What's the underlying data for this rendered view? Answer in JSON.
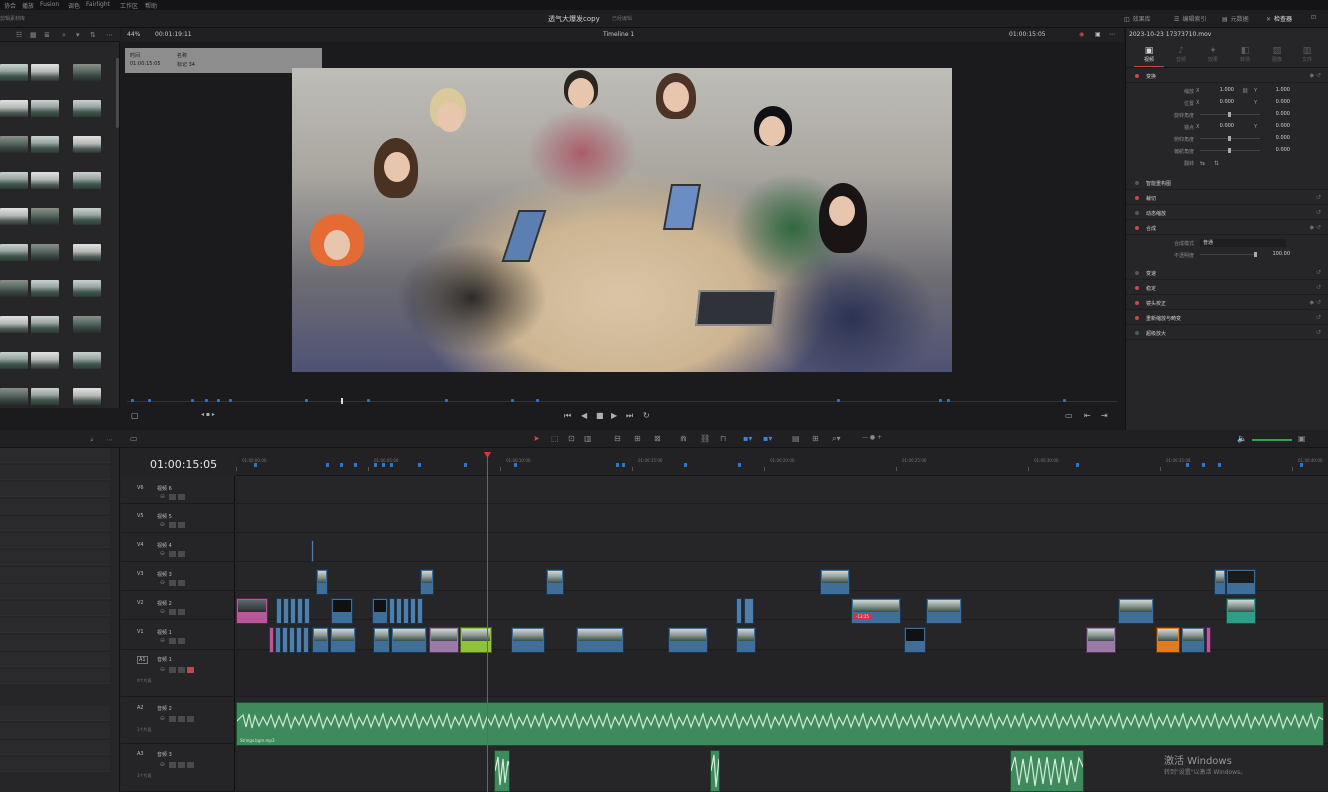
{
  "menubar": {
    "items": [
      "协合",
      "播放",
      "Fusion",
      "调色",
      "Fairlight",
      "工作区",
      "帮助"
    ]
  },
  "titlebar": {
    "media_storage": "剪辑素材库",
    "project_title": "透气大爆发copy",
    "edited_label": "已经编辑",
    "tools": [
      "效果库",
      "编辑索引",
      "元数据",
      "检查器"
    ]
  },
  "viewer": {
    "zoom": "44%",
    "source_timecode": "00:01:19:11",
    "timeline_name": "Timeline 1",
    "record_timecode": "01:00:15:05",
    "clip_info": {
      "time_label": "时间",
      "time_value": "01:00:15:05",
      "name_label": "名称",
      "name_value": "标记 34"
    }
  },
  "inspector": {
    "file_name": "2023-10-23 17373710.mov",
    "tabs": [
      "视频",
      "音频",
      "效果",
      "转场",
      "图像",
      "文件"
    ],
    "sections": [
      {
        "title": "变换",
        "dot": "on"
      },
      {
        "title": "智能重构图",
        "dot": "off"
      },
      {
        "title": "裁切",
        "dot": "on"
      },
      {
        "title": "动态缩放",
        "dot": "off"
      },
      {
        "title": "合成",
        "dot": "on"
      },
      {
        "title": "变速",
        "dot": "off"
      },
      {
        "title": "稳定",
        "dot": "on"
      },
      {
        "title": "镜头校正",
        "dot": "on"
      },
      {
        "title": "重新缩放与畸变",
        "dot": "on"
      },
      {
        "title": "超级放大",
        "dot": "off"
      }
    ],
    "transform": {
      "zoom_label": "缩放",
      "zoom_x": "1.000",
      "zoom_y": "1.000",
      "position_label": "位置",
      "position_x": "0.000",
      "position_y": "0.000",
      "rotation_label": "旋转角度",
      "rotation": "0.000",
      "anchor_label": "锚点",
      "anchor_x": "0.000",
      "anchor_y": "0.000",
      "pitch_label": "俯仰角度",
      "pitch": "0.000",
      "yaw_label": "偏航角度",
      "yaw": "0.000",
      "flip_label": "翻转"
    },
    "composite": {
      "mode_label": "合成模式",
      "mode_value": "普通",
      "opacity_label": "不透明度",
      "opacity_value": "100.00"
    }
  },
  "timeline": {
    "timecode": "01:00:15:05",
    "ruler_labels": [
      "01:00:00:00",
      "01:00:05:00",
      "01:00:10:00",
      "01:00:15:00",
      "01:00:20:00",
      "01:00:25:00",
      "01:00:30:00",
      "01:00:35:00",
      "01:00:40:00"
    ],
    "video_tracks": [
      {
        "id": "V6",
        "name": "视频 6"
      },
      {
        "id": "V5",
        "name": "视频 5"
      },
      {
        "id": "V4",
        "name": "视频 4"
      },
      {
        "id": "V3",
        "name": "视频 3"
      },
      {
        "id": "V2",
        "name": "视频 2"
      },
      {
        "id": "V1",
        "name": "视频 1"
      }
    ],
    "audio_tracks": [
      {
        "id": "A1",
        "name": "音频 1",
        "count": "0个片段"
      },
      {
        "id": "A2",
        "name": "音频 2",
        "count": "1个片段"
      },
      {
        "id": "A3",
        "name": "音频 3",
        "count": "3个片段"
      }
    ],
    "audio_clip_label": "Strings.bgm.mp3",
    "v2_time_badge": "-13:25"
  },
  "watermark": {
    "title": "激活 Windows",
    "subtitle": "转到\"设置\"以激活 Windows。"
  }
}
